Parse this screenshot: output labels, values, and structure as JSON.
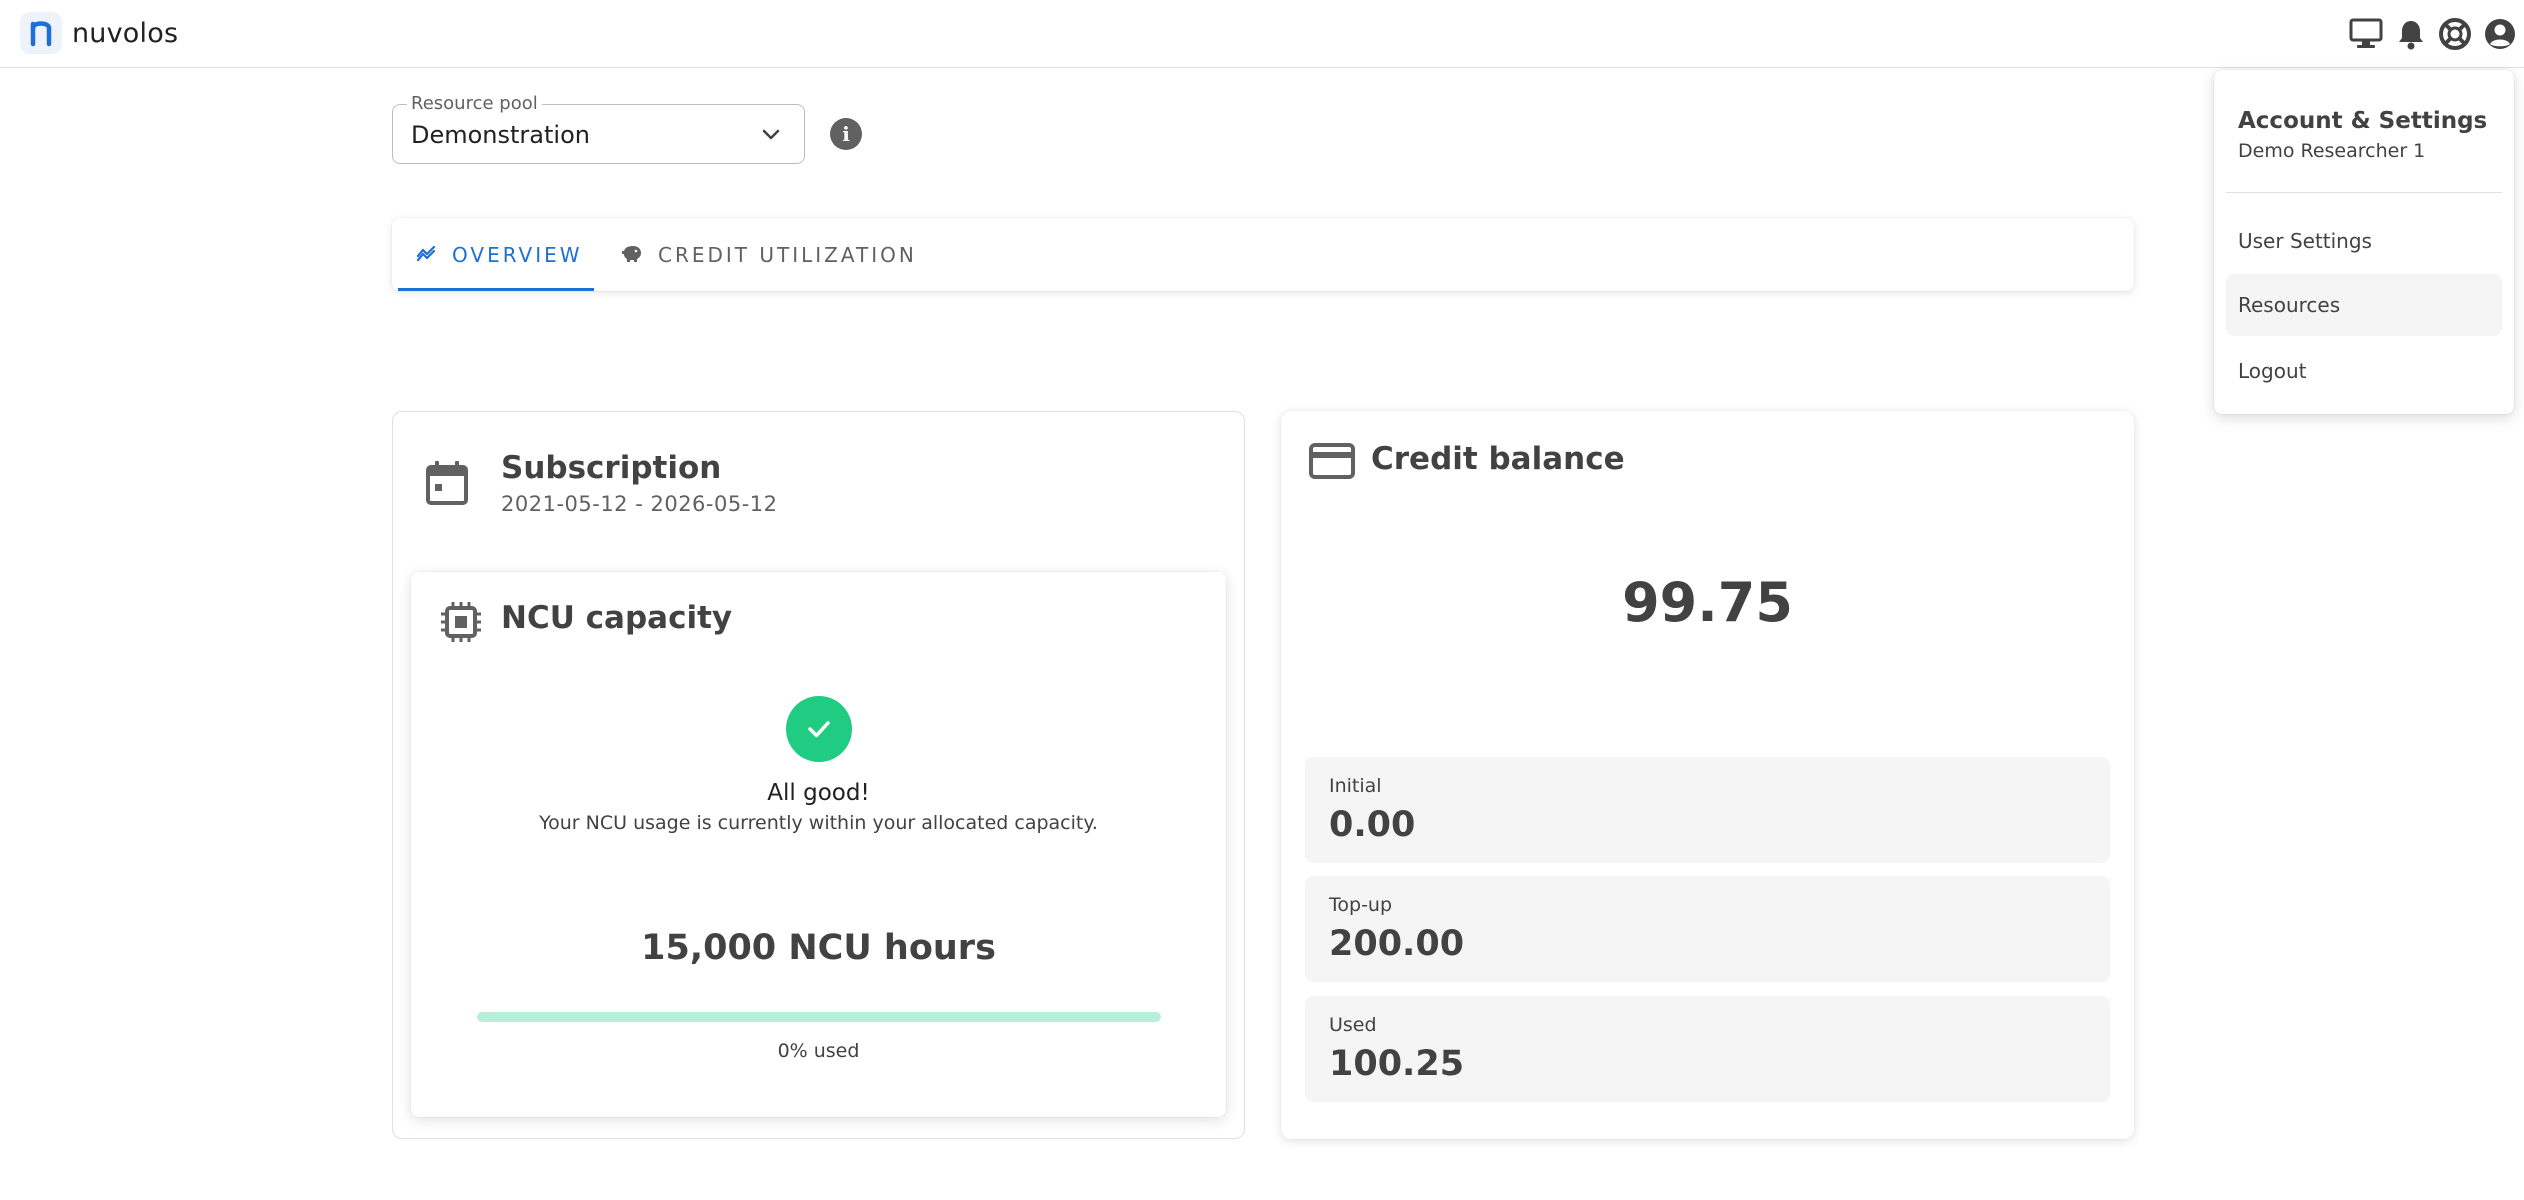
{
  "app": {
    "name": "nuvolos",
    "logo_letter": "n"
  },
  "topbar": {
    "icons": [
      "desktop-icon",
      "bell-icon",
      "lifebuoy-icon",
      "account-circle-icon"
    ]
  },
  "resource_pool": {
    "label": "Resource pool",
    "value": "Demonstration"
  },
  "tabs": [
    {
      "label": "OVERVIEW",
      "icon": "chart-line-icon",
      "active": true
    },
    {
      "label": "CREDIT UTILIZATION",
      "icon": "piggy-bank-icon",
      "active": false
    }
  ],
  "subscription": {
    "title": "Subscription",
    "dates": "2021-05-12 - 2026-05-12"
  },
  "ncu": {
    "title": "NCU capacity",
    "status_title": "All good!",
    "status_text": "Your NCU usage is currently within your allocated capacity.",
    "hours": "15,000 NCU hours",
    "used_fraction": 0,
    "used_label": "0% used"
  },
  "credit": {
    "title": "Credit balance",
    "balance": "99.75",
    "stats": [
      {
        "label": "Initial",
        "value": "0.00"
      },
      {
        "label": "Top-up",
        "value": "200.00"
      },
      {
        "label": "Used",
        "value": "100.25"
      }
    ]
  },
  "account_menu": {
    "title": "Account & Settings",
    "user": "Demo Researcher 1",
    "items": [
      "User Settings",
      "Resources",
      "Logout"
    ]
  },
  "colors": {
    "accent": "#1e6fd9",
    "success": "#1fcc82",
    "success_track": "#b9eedb",
    "text": "#424242"
  }
}
